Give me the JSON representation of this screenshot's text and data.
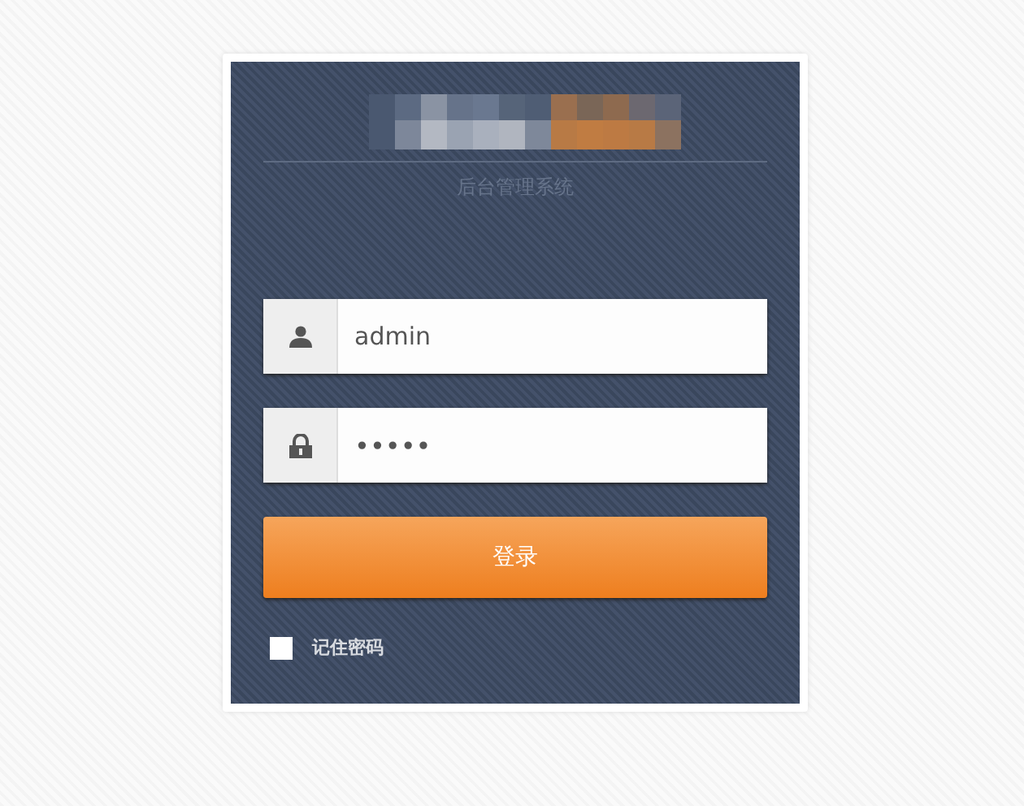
{
  "subtitle": "后台管理系统",
  "fields": [
    {
      "kind": "user",
      "value": "admin"
    },
    {
      "kind": "lock",
      "value": "•••••"
    }
  ],
  "login_button": "登录",
  "remember": {
    "label": "记住密码",
    "checked": false
  }
}
